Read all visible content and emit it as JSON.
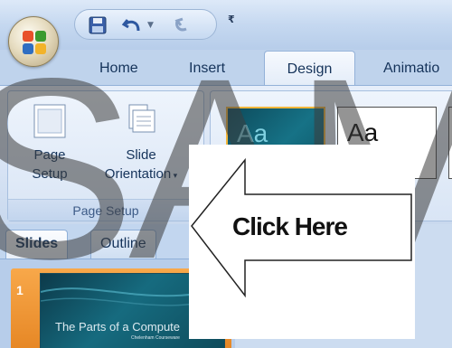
{
  "quick_access": {
    "items": [
      {
        "icon": "save-icon"
      },
      {
        "icon": "undo-icon"
      },
      {
        "icon": "redo-icon"
      },
      {
        "icon": "customize-qat-icon"
      }
    ]
  },
  "ribbon": {
    "tabs": [
      {
        "label": "Home",
        "active": false
      },
      {
        "label": "Insert",
        "active": false
      },
      {
        "label": "Design",
        "active": true
      },
      {
        "label": "Animatio",
        "active": false
      }
    ],
    "groups": {
      "page_setup": {
        "label": "Page Setup",
        "buttons": [
          {
            "line1": "Page",
            "line2": "Setup"
          },
          {
            "line1": "Slide",
            "line2": "Orientation"
          }
        ]
      },
      "themes": {
        "items": [
          {
            "label": "Aa",
            "style": "dark-teal"
          },
          {
            "label": "Aa",
            "style": "office-white"
          }
        ]
      }
    }
  },
  "panel": {
    "tabs": [
      {
        "label": "Slides",
        "active": true
      },
      {
        "label": "Outline",
        "active": false
      }
    ],
    "slides": [
      {
        "number": "1",
        "title": "The Parts of a Compute",
        "subtitle": "Chelenham Courseware"
      }
    ]
  },
  "watermark": {
    "text": "SAM"
  },
  "callout": {
    "text": "Click Here",
    "arrow_direction": "left"
  },
  "colors": {
    "ribbon_bg": "#d7e3f4",
    "tab_text": "#15335a",
    "theme_accent": "#f3b63a",
    "slide_selection": "#f39a33",
    "slide_bg": "#166b7f"
  }
}
